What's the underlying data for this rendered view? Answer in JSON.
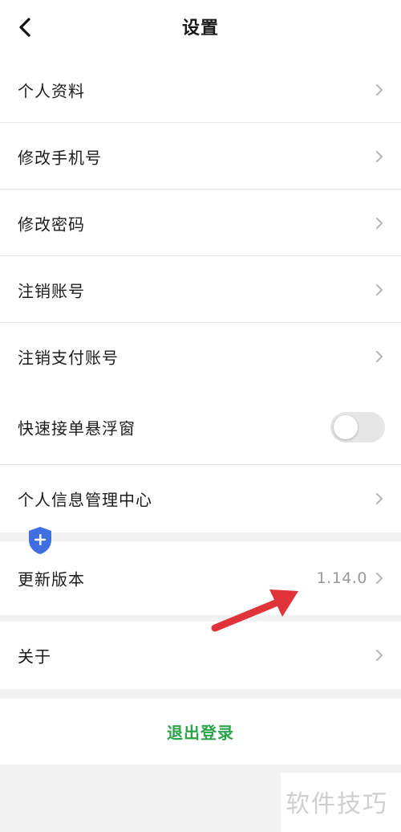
{
  "header": {
    "title": "设置"
  },
  "settings": {
    "items": [
      {
        "label": "个人资料"
      },
      {
        "label": "修改手机号"
      },
      {
        "label": "修改密码"
      },
      {
        "label": "注销账号"
      },
      {
        "label": "注销支付账号"
      },
      {
        "label": "快速接单悬浮窗",
        "toggle_on": false
      },
      {
        "label": "个人信息管理中心"
      }
    ],
    "version": {
      "label": "更新版本",
      "value": "1.14.0"
    },
    "about": {
      "label": "关于"
    }
  },
  "logout": {
    "label": "退出登录"
  },
  "watermark": {
    "text": "软件技巧"
  },
  "colors": {
    "accent": "#2aa34a",
    "annotation_arrow": "#e0333a",
    "shield": "#3f6fe0"
  }
}
